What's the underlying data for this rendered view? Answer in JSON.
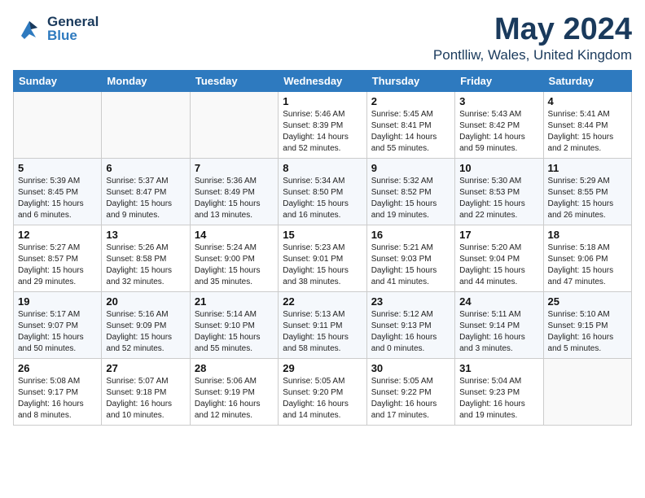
{
  "logo": {
    "general": "General",
    "blue": "Blue"
  },
  "title": "May 2024",
  "subtitle": "Pontlliw, Wales, United Kingdom",
  "days_of_week": [
    "Sunday",
    "Monday",
    "Tuesday",
    "Wednesday",
    "Thursday",
    "Friday",
    "Saturday"
  ],
  "weeks": [
    [
      {
        "day": "",
        "info": ""
      },
      {
        "day": "",
        "info": ""
      },
      {
        "day": "",
        "info": ""
      },
      {
        "day": "1",
        "info": "Sunrise: 5:46 AM\nSunset: 8:39 PM\nDaylight: 14 hours and 52 minutes."
      },
      {
        "day": "2",
        "info": "Sunrise: 5:45 AM\nSunset: 8:41 PM\nDaylight: 14 hours and 55 minutes."
      },
      {
        "day": "3",
        "info": "Sunrise: 5:43 AM\nSunset: 8:42 PM\nDaylight: 14 hours and 59 minutes."
      },
      {
        "day": "4",
        "info": "Sunrise: 5:41 AM\nSunset: 8:44 PM\nDaylight: 15 hours and 2 minutes."
      }
    ],
    [
      {
        "day": "5",
        "info": "Sunrise: 5:39 AM\nSunset: 8:45 PM\nDaylight: 15 hours and 6 minutes."
      },
      {
        "day": "6",
        "info": "Sunrise: 5:37 AM\nSunset: 8:47 PM\nDaylight: 15 hours and 9 minutes."
      },
      {
        "day": "7",
        "info": "Sunrise: 5:36 AM\nSunset: 8:49 PM\nDaylight: 15 hours and 13 minutes."
      },
      {
        "day": "8",
        "info": "Sunrise: 5:34 AM\nSunset: 8:50 PM\nDaylight: 15 hours and 16 minutes."
      },
      {
        "day": "9",
        "info": "Sunrise: 5:32 AM\nSunset: 8:52 PM\nDaylight: 15 hours and 19 minutes."
      },
      {
        "day": "10",
        "info": "Sunrise: 5:30 AM\nSunset: 8:53 PM\nDaylight: 15 hours and 22 minutes."
      },
      {
        "day": "11",
        "info": "Sunrise: 5:29 AM\nSunset: 8:55 PM\nDaylight: 15 hours and 26 minutes."
      }
    ],
    [
      {
        "day": "12",
        "info": "Sunrise: 5:27 AM\nSunset: 8:57 PM\nDaylight: 15 hours and 29 minutes."
      },
      {
        "day": "13",
        "info": "Sunrise: 5:26 AM\nSunset: 8:58 PM\nDaylight: 15 hours and 32 minutes."
      },
      {
        "day": "14",
        "info": "Sunrise: 5:24 AM\nSunset: 9:00 PM\nDaylight: 15 hours and 35 minutes."
      },
      {
        "day": "15",
        "info": "Sunrise: 5:23 AM\nSunset: 9:01 PM\nDaylight: 15 hours and 38 minutes."
      },
      {
        "day": "16",
        "info": "Sunrise: 5:21 AM\nSunset: 9:03 PM\nDaylight: 15 hours and 41 minutes."
      },
      {
        "day": "17",
        "info": "Sunrise: 5:20 AM\nSunset: 9:04 PM\nDaylight: 15 hours and 44 minutes."
      },
      {
        "day": "18",
        "info": "Sunrise: 5:18 AM\nSunset: 9:06 PM\nDaylight: 15 hours and 47 minutes."
      }
    ],
    [
      {
        "day": "19",
        "info": "Sunrise: 5:17 AM\nSunset: 9:07 PM\nDaylight: 15 hours and 50 minutes."
      },
      {
        "day": "20",
        "info": "Sunrise: 5:16 AM\nSunset: 9:09 PM\nDaylight: 15 hours and 52 minutes."
      },
      {
        "day": "21",
        "info": "Sunrise: 5:14 AM\nSunset: 9:10 PM\nDaylight: 15 hours and 55 minutes."
      },
      {
        "day": "22",
        "info": "Sunrise: 5:13 AM\nSunset: 9:11 PM\nDaylight: 15 hours and 58 minutes."
      },
      {
        "day": "23",
        "info": "Sunrise: 5:12 AM\nSunset: 9:13 PM\nDaylight: 16 hours and 0 minutes."
      },
      {
        "day": "24",
        "info": "Sunrise: 5:11 AM\nSunset: 9:14 PM\nDaylight: 16 hours and 3 minutes."
      },
      {
        "day": "25",
        "info": "Sunrise: 5:10 AM\nSunset: 9:15 PM\nDaylight: 16 hours and 5 minutes."
      }
    ],
    [
      {
        "day": "26",
        "info": "Sunrise: 5:08 AM\nSunset: 9:17 PM\nDaylight: 16 hours and 8 minutes."
      },
      {
        "day": "27",
        "info": "Sunrise: 5:07 AM\nSunset: 9:18 PM\nDaylight: 16 hours and 10 minutes."
      },
      {
        "day": "28",
        "info": "Sunrise: 5:06 AM\nSunset: 9:19 PM\nDaylight: 16 hours and 12 minutes."
      },
      {
        "day": "29",
        "info": "Sunrise: 5:05 AM\nSunset: 9:20 PM\nDaylight: 16 hours and 14 minutes."
      },
      {
        "day": "30",
        "info": "Sunrise: 5:05 AM\nSunset: 9:22 PM\nDaylight: 16 hours and 17 minutes."
      },
      {
        "day": "31",
        "info": "Sunrise: 5:04 AM\nSunset: 9:23 PM\nDaylight: 16 hours and 19 minutes."
      },
      {
        "day": "",
        "info": ""
      }
    ]
  ]
}
